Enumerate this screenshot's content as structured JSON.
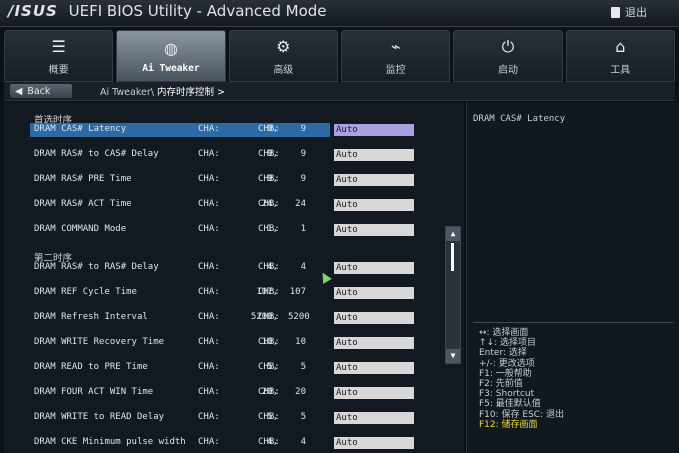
{
  "titlebar": {
    "logo": "/ISUS",
    "title": "UEFI BIOS Utility - Advanced Mode",
    "exit_label": "退出"
  },
  "tabs": [
    {
      "icon": "list-icon",
      "glyph": "☰",
      "label": "概要",
      "active": false
    },
    {
      "icon": "ai-tweaker-icon",
      "glyph": "◍",
      "label": "Ai Tweaker",
      "active": true
    },
    {
      "icon": "advanced-icon",
      "glyph": "⚙",
      "label": "高级",
      "active": false
    },
    {
      "icon": "monitor-icon",
      "glyph": "⌁",
      "label": "监控",
      "active": false
    },
    {
      "icon": "power-icon",
      "glyph": "⏻",
      "label": "启动",
      "active": false
    },
    {
      "icon": "tool-icon",
      "glyph": "⌂",
      "label": "工具",
      "active": false
    }
  ],
  "crumb": {
    "back_label": "Back",
    "path": "Ai Tweaker\\",
    "current": "内存时序控制 >"
  },
  "sections": {
    "primary": "首选时序",
    "secondary": "第二时序"
  },
  "rows": [
    {
      "name": "DRAM CAS# Latency",
      "cha_label": "CHA:",
      "cha": "9,",
      "chb_label": "CHB:",
      "chb": "9",
      "value": "Auto",
      "selected": true
    },
    {
      "name": "DRAM RAS# to CAS# Delay",
      "cha_label": "CHA:",
      "cha": "9,",
      "chb_label": "CHB:",
      "chb": "9",
      "value": "Auto",
      "selected": false
    },
    {
      "name": "DRAM RAS# PRE Time",
      "cha_label": "CHA:",
      "cha": "9,",
      "chb_label": "CHB:",
      "chb": "9",
      "value": "Auto",
      "selected": false
    },
    {
      "name": "DRAM RAS# ACT Time",
      "cha_label": "CHA:",
      "cha": "24,",
      "chb_label": "CHB:",
      "chb": "24",
      "value": "Auto",
      "selected": false
    },
    {
      "name": "DRAM COMMAND Mode",
      "cha_label": "CHA:",
      "cha": "1,",
      "chb_label": "CHB:",
      "chb": "1",
      "value": "Auto",
      "selected": false
    },
    {
      "name": "DRAM RAS# to RAS# Delay",
      "cha_label": "CHA:",
      "cha": "4,",
      "chb_label": "CHB:",
      "chb": "4",
      "value": "Auto",
      "selected": false
    },
    {
      "name": "DRAM REF Cycle Time",
      "cha_label": "CHA:",
      "cha": "107,",
      "chb_label": "CHB:",
      "chb": "107",
      "value": "Auto",
      "selected": false
    },
    {
      "name": "DRAM Refresh Interval",
      "cha_label": "CHA:",
      "cha": "5200,",
      "chb_label": "CHB:",
      "chb": "5200",
      "value": "Auto",
      "selected": false
    },
    {
      "name": "DRAM WRITE Recovery Time",
      "cha_label": "CHA:",
      "cha": "10,",
      "chb_label": "CHB:",
      "chb": "10",
      "value": "Auto",
      "selected": false
    },
    {
      "name": "DRAM READ to PRE Time",
      "cha_label": "CHA:",
      "cha": "5,",
      "chb_label": "CHB:",
      "chb": "5",
      "value": "Auto",
      "selected": false
    },
    {
      "name": "DRAM FOUR ACT WIN Time",
      "cha_label": "CHA:",
      "cha": "20,",
      "chb_label": "CHB:",
      "chb": "20",
      "value": "Auto",
      "selected": false
    },
    {
      "name": "DRAM WRITE to READ Delay",
      "cha_label": "CHA:",
      "cha": "5,",
      "chb_label": "CHB:",
      "chb": "5",
      "value": "Auto",
      "selected": false
    },
    {
      "name": "DRAM CKE Minimum pulse width",
      "cha_label": "CHA:",
      "cha": "4,",
      "chb_label": "CHB:",
      "chb": "4",
      "value": "Auto",
      "selected": false
    }
  ],
  "help": {
    "title": "DRAM CAS# Latency",
    "keys": [
      {
        "text": "↔: 选择画面",
        "hot": false
      },
      {
        "text": "↑↓: 选择项目",
        "hot": false
      },
      {
        "text": "Enter: 选择",
        "hot": false
      },
      {
        "text": "+/-: 更改选项",
        "hot": false
      },
      {
        "text": "F1: 一般帮助",
        "hot": false
      },
      {
        "text": "F2: 先前值",
        "hot": false
      },
      {
        "text": "F3: Shortcut",
        "hot": false
      },
      {
        "text": "F5: 最佳默认值",
        "hot": false
      },
      {
        "text": "F10: 保存  ESC: 退出",
        "hot": false
      },
      {
        "text": "F12: 储存画面",
        "hot": true
      }
    ]
  },
  "colors": {
    "selection": "#2c6aa6",
    "selected_value": "#a9a1e0",
    "hotkey": "#f2d73a"
  }
}
